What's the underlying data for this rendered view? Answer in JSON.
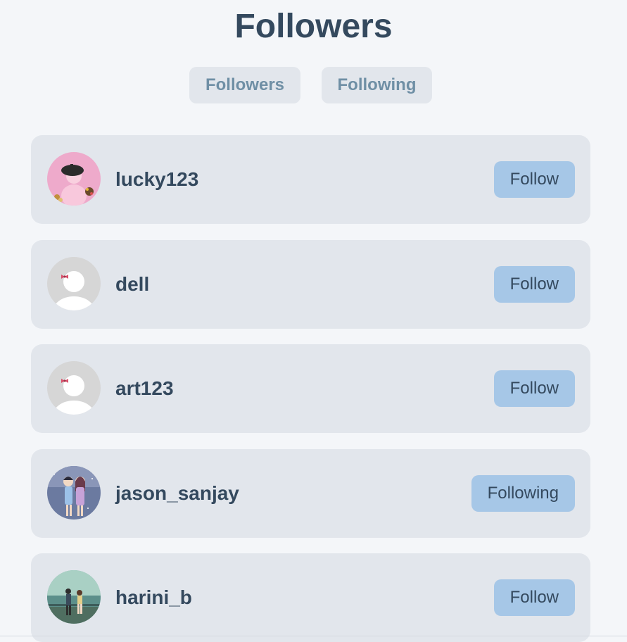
{
  "page": {
    "title": "Followers"
  },
  "tabs": [
    {
      "label": "Followers"
    },
    {
      "label": "Following"
    }
  ],
  "users": [
    {
      "username": "lucky123",
      "button": "Follow",
      "avatar": "pink-beret-avatar"
    },
    {
      "username": "dell",
      "button": "Follow",
      "avatar": "default-avatar-with-bow"
    },
    {
      "username": "art123",
      "button": "Follow",
      "avatar": "default-avatar-with-bow"
    },
    {
      "username": "jason_sanjay",
      "button": "Following",
      "avatar": "anime-couple-avatar"
    },
    {
      "username": "harini_b",
      "button": "Follow",
      "avatar": "anime-scenery-avatar"
    }
  ]
}
